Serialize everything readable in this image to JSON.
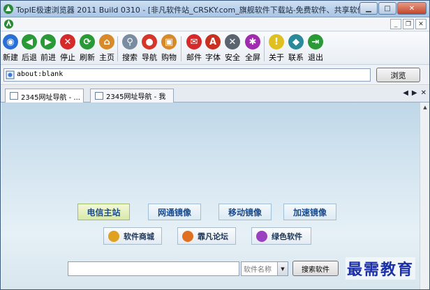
{
  "window": {
    "title": "TopIE极速浏览器 2011 Build 0310 - [非凡软件站_CRSKY.com_旗舰软件下载站-免费软件、共享软件..."
  },
  "toolbar": {
    "items": [
      {
        "label": "新建",
        "icon": "globe-icon",
        "color": "#2a6fd6"
      },
      {
        "label": "后退",
        "icon": "back-arrow-icon",
        "color": "#2a9a36"
      },
      {
        "label": "前进",
        "icon": "forward-arrow-icon",
        "color": "#2a9a36"
      },
      {
        "label": "停止",
        "icon": "stop-icon",
        "color": "#d62a2a"
      },
      {
        "label": "刷新",
        "icon": "refresh-icon",
        "color": "#2a9a36"
      },
      {
        "label": "主页",
        "icon": "home-icon",
        "color": "#d68a2a"
      },
      {
        "label": "搜索",
        "icon": "search-icon",
        "color": "#7a8ca0"
      },
      {
        "label": "导航",
        "icon": "balloon-icon",
        "color": "#d6362a"
      },
      {
        "label": "购物",
        "icon": "cart-icon",
        "color": "#d68a2a"
      },
      {
        "label": "邮件",
        "icon": "mail-icon",
        "color": "#d62a2a"
      },
      {
        "label": "字体",
        "icon": "font-icon",
        "color": "#c83020"
      },
      {
        "label": "安全",
        "icon": "tools-icon",
        "color": "#5a6470"
      },
      {
        "label": "全屏",
        "icon": "fullscreen-icon",
        "color": "#a02ab0"
      },
      {
        "label": "关于",
        "icon": "warning-icon",
        "color": "#e0c020"
      },
      {
        "label": "联系",
        "icon": "diamond-icon",
        "color": "#2a8a9a"
      },
      {
        "label": "退出",
        "icon": "exit-icon",
        "color": "#2a9a36"
      }
    ]
  },
  "address": {
    "value": "about:blank",
    "go_label": "浏览"
  },
  "tabs": [
    {
      "label": "2345网址导航 - ..."
    },
    {
      "label": "2345网址导航 - 我"
    }
  ],
  "content": {
    "mirrors": [
      {
        "label": "电信主站"
      },
      {
        "label": "网通镜像"
      },
      {
        "label": "移动镜像"
      },
      {
        "label": "加速镜像"
      }
    ],
    "shortcuts": [
      {
        "label": "软件商城",
        "color": "#e0a020"
      },
      {
        "label": "霏凡论坛",
        "color": "#e07020"
      },
      {
        "label": "绿色软件",
        "color": "#9a40c0"
      }
    ],
    "search": {
      "value": "",
      "category": "软件名称",
      "button": "搜索软件"
    }
  },
  "watermark": "最需教育"
}
